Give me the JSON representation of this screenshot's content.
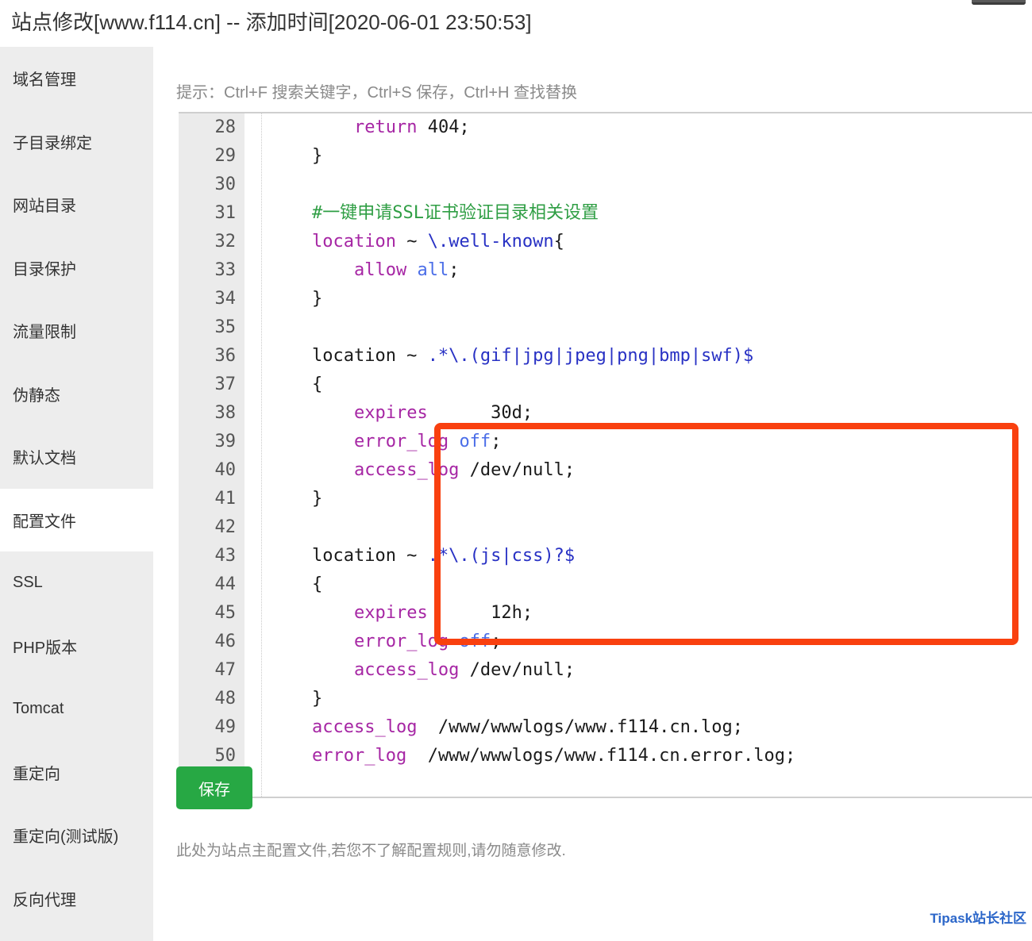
{
  "window": {
    "title": "站点修改[www.f114.cn] -- 添加时间[2020-06-01 23:50:53]",
    "chrome_button": ""
  },
  "sidebar": {
    "items": [
      {
        "label": "域名管理",
        "active": false
      },
      {
        "label": "子目录绑定",
        "active": false
      },
      {
        "label": "网站目录",
        "active": false
      },
      {
        "label": "目录保护",
        "active": false
      },
      {
        "label": "流量限制",
        "active": false
      },
      {
        "label": "伪静态",
        "active": false
      },
      {
        "label": "默认文档",
        "active": false
      },
      {
        "label": "配置文件",
        "active": true
      },
      {
        "label": "SSL",
        "active": false
      },
      {
        "label": "PHP版本",
        "active": false
      },
      {
        "label": "Tomcat",
        "active": false
      },
      {
        "label": "重定向",
        "active": false
      },
      {
        "label": "重定向(测试版)",
        "active": false
      },
      {
        "label": "反向代理",
        "active": false
      }
    ]
  },
  "main": {
    "hint": "提示：Ctrl+F 搜索关键字，Ctrl+S 保存，Ctrl+H 查找替换",
    "save_label": "保存",
    "note": "此处为站点主配置文件,若您不了解配置规则,请勿随意修改.",
    "brand": "Tipask站长社区"
  },
  "editor": {
    "first_line": 28,
    "highlight_color": "#f9400f",
    "lines": [
      {
        "n": 28,
        "tokens": [
          {
            "t": "        ",
            "c": "plain"
          },
          {
            "t": "return",
            "c": "kw"
          },
          {
            "t": " 404;",
            "c": "plain"
          }
        ]
      },
      {
        "n": 29,
        "tokens": [
          {
            "t": "    }",
            "c": "plain"
          }
        ]
      },
      {
        "n": 30,
        "tokens": [
          {
            "t": "",
            "c": "plain"
          }
        ]
      },
      {
        "n": 31,
        "tokens": [
          {
            "t": "    #一键申请SSL证书验证目录相关设置",
            "c": "cmt"
          }
        ]
      },
      {
        "n": 32,
        "tokens": [
          {
            "t": "    ",
            "c": "plain"
          },
          {
            "t": "location",
            "c": "kw"
          },
          {
            "t": " ~ ",
            "c": "plain"
          },
          {
            "t": "\\.well-known",
            "c": "reg"
          },
          {
            "t": "{",
            "c": "plain"
          }
        ]
      },
      {
        "n": 33,
        "tokens": [
          {
            "t": "        ",
            "c": "plain"
          },
          {
            "t": "allow",
            "c": "kw"
          },
          {
            "t": " ",
            "c": "plain"
          },
          {
            "t": "all",
            "c": "val"
          },
          {
            "t": ";",
            "c": "plain"
          }
        ]
      },
      {
        "n": 34,
        "tokens": [
          {
            "t": "    }",
            "c": "plain"
          }
        ]
      },
      {
        "n": 35,
        "tokens": [
          {
            "t": "",
            "c": "plain"
          }
        ]
      },
      {
        "n": 36,
        "tokens": [
          {
            "t": "    location ~ ",
            "c": "plain"
          },
          {
            "t": ".*\\.(gif|jpg|jpeg|png|bmp|swf)$",
            "c": "reg"
          }
        ]
      },
      {
        "n": 37,
        "tokens": [
          {
            "t": "    {",
            "c": "plain"
          }
        ]
      },
      {
        "n": 38,
        "tokens": [
          {
            "t": "        ",
            "c": "plain"
          },
          {
            "t": "expires",
            "c": "kw"
          },
          {
            "t": "      30d;",
            "c": "plain"
          }
        ]
      },
      {
        "n": 39,
        "tokens": [
          {
            "t": "        ",
            "c": "plain"
          },
          {
            "t": "error_log",
            "c": "kw"
          },
          {
            "t": " ",
            "c": "plain"
          },
          {
            "t": "off",
            "c": "val"
          },
          {
            "t": ";",
            "c": "plain"
          }
        ]
      },
      {
        "n": 40,
        "tokens": [
          {
            "t": "        ",
            "c": "plain"
          },
          {
            "t": "access_log",
            "c": "kw"
          },
          {
            "t": " /dev/null;",
            "c": "plain"
          }
        ]
      },
      {
        "n": 41,
        "tokens": [
          {
            "t": "    }",
            "c": "plain"
          }
        ]
      },
      {
        "n": 42,
        "tokens": [
          {
            "t": "",
            "c": "plain"
          }
        ]
      },
      {
        "n": 43,
        "tokens": [
          {
            "t": "    location ~ ",
            "c": "plain"
          },
          {
            "t": ".*\\.(js|css)?$",
            "c": "reg"
          }
        ]
      },
      {
        "n": 44,
        "tokens": [
          {
            "t": "    {",
            "c": "plain"
          }
        ]
      },
      {
        "n": 45,
        "tokens": [
          {
            "t": "        ",
            "c": "plain"
          },
          {
            "t": "expires",
            "c": "kw"
          },
          {
            "t": "      12h;",
            "c": "plain"
          }
        ]
      },
      {
        "n": 46,
        "tokens": [
          {
            "t": "        ",
            "c": "plain"
          },
          {
            "t": "error_log",
            "c": "kw"
          },
          {
            "t": " ",
            "c": "plain"
          },
          {
            "t": "off",
            "c": "val"
          },
          {
            "t": ";",
            "c": "plain"
          }
        ]
      },
      {
        "n": 47,
        "tokens": [
          {
            "t": "        ",
            "c": "plain"
          },
          {
            "t": "access_log",
            "c": "kw"
          },
          {
            "t": " /dev/null;",
            "c": "plain"
          }
        ]
      },
      {
        "n": 48,
        "tokens": [
          {
            "t": "    }",
            "c": "plain"
          }
        ]
      },
      {
        "n": 49,
        "tokens": [
          {
            "t": "    ",
            "c": "plain"
          },
          {
            "t": "access_log",
            "c": "kw"
          },
          {
            "t": "  /www/wwwlogs/www.f114.cn.log;",
            "c": "plain"
          }
        ]
      },
      {
        "n": 50,
        "tokens": [
          {
            "t": "    ",
            "c": "plain"
          },
          {
            "t": "error_log",
            "c": "kw"
          },
          {
            "t": "  /www/wwwlogs/www.f114.cn.error.log;",
            "c": "plain"
          }
        ]
      }
    ],
    "highlight_from_line": 36,
    "highlight_to_line": 41
  }
}
